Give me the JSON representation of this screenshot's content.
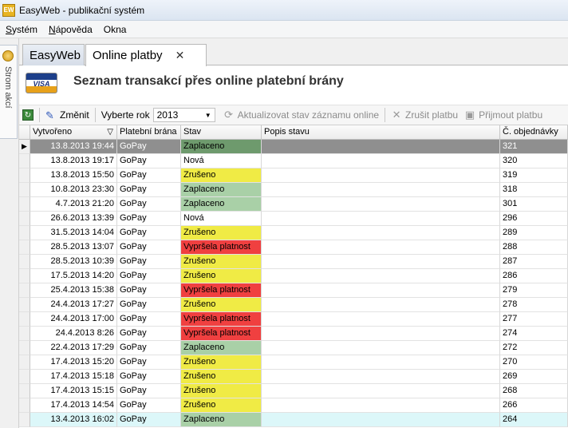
{
  "window": {
    "title": "EasyWeb - publikační systém",
    "icon_text": "EW"
  },
  "menu": {
    "items": [
      {
        "label": "Systém",
        "underline": "S",
        "rest": "ystém"
      },
      {
        "label": "Nápověda",
        "underline": "N",
        "rest": "ápověda"
      },
      {
        "label": "Okna",
        "underline": "",
        "rest": "Okna"
      }
    ]
  },
  "side_panel": {
    "label": "Strom akcí"
  },
  "tabs": [
    {
      "label": "EasyWeb",
      "active": false
    },
    {
      "label": "Online platby",
      "active": true,
      "close": "✕"
    }
  ],
  "header": {
    "logo_text": "VISA",
    "title": "Seznam transakcí přes online platební brány"
  },
  "toolbar": {
    "edit_label": "Změnit",
    "year_label": "Vyberte rok",
    "year_value": "2013",
    "update_label": "Aktualizovat stav záznamu online",
    "cancel_label": "Zrušit platbu",
    "accept_label": "Přijmout platbu"
  },
  "grid": {
    "columns": [
      "Vytvořeno",
      "Platební brána",
      "Stav",
      "Popis stavu",
      "Č. objednávky"
    ],
    "sort_indicator": "▽",
    "selected_marker": "▶",
    "rows": [
      {
        "created": "13.8.2013 19:44",
        "gateway": "GoPay",
        "status": "Zaplaceno",
        "kind": "zaplaceno",
        "desc": "",
        "order": "321"
      },
      {
        "created": "13.8.2013 19:17",
        "gateway": "GoPay",
        "status": "Nová",
        "kind": "nova",
        "desc": "",
        "order": "320"
      },
      {
        "created": "13.8.2013 15:50",
        "gateway": "GoPay",
        "status": "Zrušeno",
        "kind": "zruseno",
        "desc": "",
        "order": "319"
      },
      {
        "created": "10.8.2013 23:30",
        "gateway": "GoPay",
        "status": "Zaplaceno",
        "kind": "zaplaceno",
        "desc": "",
        "order": "318"
      },
      {
        "created": "4.7.2013 21:20",
        "gateway": "GoPay",
        "status": "Zaplaceno",
        "kind": "zaplaceno",
        "desc": "",
        "order": "301"
      },
      {
        "created": "26.6.2013 13:39",
        "gateway": "GoPay",
        "status": "Nová",
        "kind": "nova",
        "desc": "",
        "order": "296"
      },
      {
        "created": "31.5.2013 14:04",
        "gateway": "GoPay",
        "status": "Zrušeno",
        "kind": "zruseno",
        "desc": "",
        "order": "289"
      },
      {
        "created": "28.5.2013 13:07",
        "gateway": "GoPay",
        "status": "Vypršela platnost",
        "kind": "vyprsela",
        "desc": "",
        "order": "288"
      },
      {
        "created": "28.5.2013 10:39",
        "gateway": "GoPay",
        "status": "Zrušeno",
        "kind": "zruseno",
        "desc": "",
        "order": "287"
      },
      {
        "created": "17.5.2013 14:20",
        "gateway": "GoPay",
        "status": "Zrušeno",
        "kind": "zruseno",
        "desc": "",
        "order": "286"
      },
      {
        "created": "25.4.2013 15:38",
        "gateway": "GoPay",
        "status": "Vypršela platnost",
        "kind": "vyprsela",
        "desc": "",
        "order": "279"
      },
      {
        "created": "24.4.2013 17:27",
        "gateway": "GoPay",
        "status": "Zrušeno",
        "kind": "zruseno",
        "desc": "",
        "order": "278"
      },
      {
        "created": "24.4.2013 17:00",
        "gateway": "GoPay",
        "status": "Vypršela platnost",
        "kind": "vyprsela",
        "desc": "",
        "order": "277"
      },
      {
        "created": "24.4.2013 8:26",
        "gateway": "GoPay",
        "status": "Vypršela platnost",
        "kind": "vyprsela",
        "desc": "",
        "order": "274"
      },
      {
        "created": "22.4.2013 17:29",
        "gateway": "GoPay",
        "status": "Zaplaceno",
        "kind": "zaplaceno",
        "desc": "",
        "order": "272"
      },
      {
        "created": "17.4.2013 15:20",
        "gateway": "GoPay",
        "status": "Zrušeno",
        "kind": "zruseno",
        "desc": "",
        "order": "270"
      },
      {
        "created": "17.4.2013 15:18",
        "gateway": "GoPay",
        "status": "Zrušeno",
        "kind": "zruseno",
        "desc": "",
        "order": "269"
      },
      {
        "created": "17.4.2013 15:15",
        "gateway": "GoPay",
        "status": "Zrušeno",
        "kind": "zruseno",
        "desc": "",
        "order": "268"
      },
      {
        "created": "17.4.2013 14:54",
        "gateway": "GoPay",
        "status": "Zrušeno",
        "kind": "zruseno",
        "desc": "",
        "order": "266"
      },
      {
        "created": "13.4.2013 16:02",
        "gateway": "GoPay",
        "status": "Zaplaceno",
        "kind": "zaplaceno",
        "desc": "",
        "order": "264"
      }
    ]
  },
  "colors": {
    "paid": "#a9d0a7",
    "cancelled": "#f0eb45",
    "expired": "#f04040",
    "selected_row": "#8f8f8f"
  }
}
